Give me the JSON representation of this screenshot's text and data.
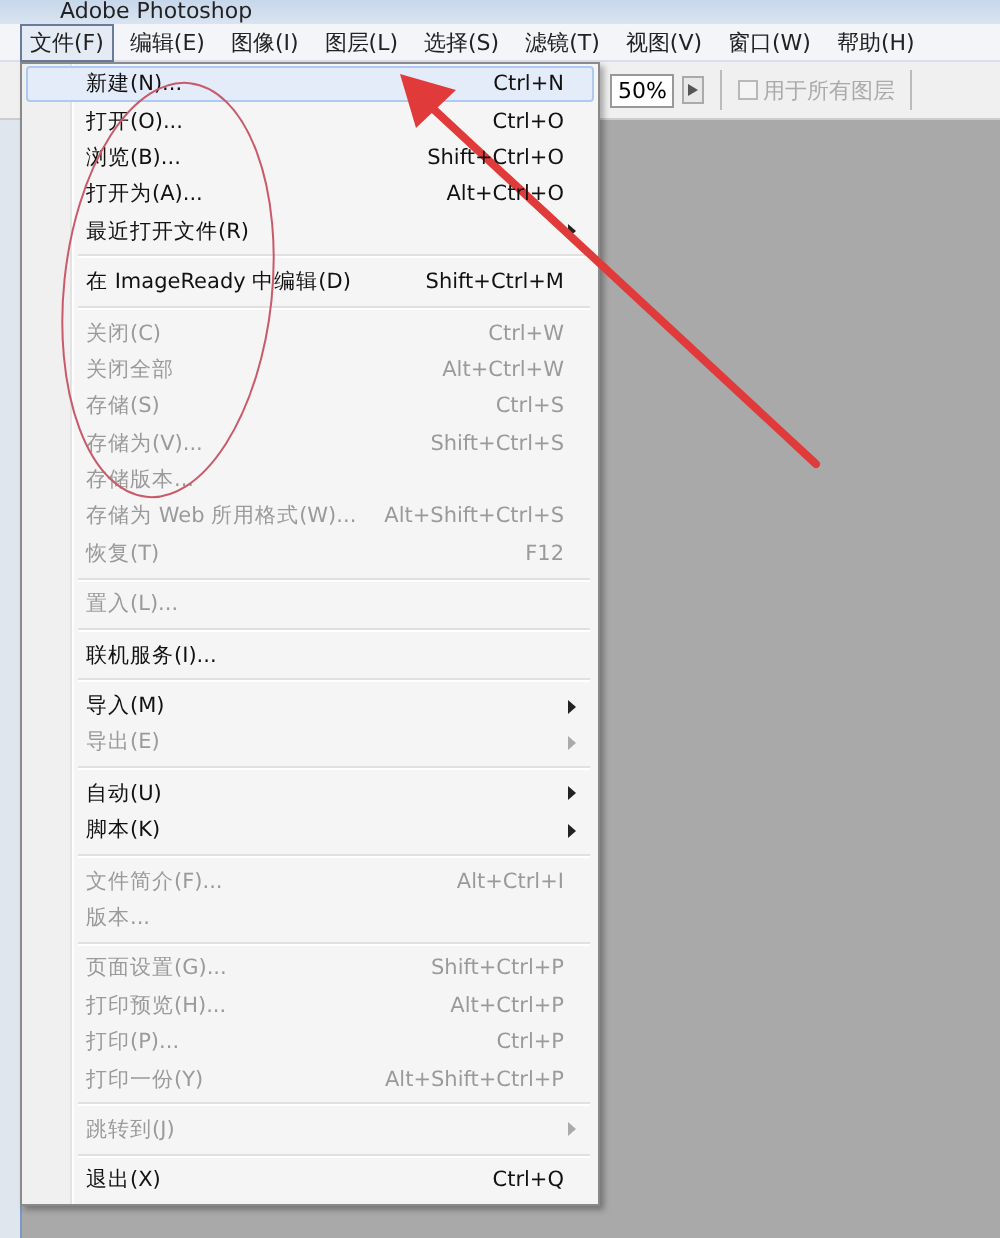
{
  "window": {
    "title": "Adobe Photoshop"
  },
  "menu_bar": [
    {
      "label": "文件(F)",
      "selected": true
    },
    {
      "label": "编辑(E)",
      "selected": false
    },
    {
      "label": "图像(I)",
      "selected": false
    },
    {
      "label": "图层(L)",
      "selected": false
    },
    {
      "label": "选择(S)",
      "selected": false
    },
    {
      "label": "滤镜(T)",
      "selected": false
    },
    {
      "label": "视图(V)",
      "selected": false
    },
    {
      "label": "窗口(W)",
      "selected": false
    },
    {
      "label": "帮助(H)",
      "selected": false
    }
  ],
  "options_bar": {
    "zoom_value": "50%",
    "all_layers": {
      "label": "用于所有图层",
      "checked": false,
      "disabled": true
    }
  },
  "file_menu": [
    [
      {
        "label": "新建(N)...",
        "shortcut": "Ctrl+N",
        "selected": true,
        "disabled": false,
        "submenu": false
      },
      {
        "label": "打开(O)...",
        "shortcut": "Ctrl+O",
        "selected": false,
        "disabled": false,
        "submenu": false
      },
      {
        "label": "浏览(B)...",
        "shortcut": "Shift+Ctrl+O",
        "selected": false,
        "disabled": false,
        "submenu": false
      },
      {
        "label": "打开为(A)...",
        "shortcut": "Alt+Ctrl+O",
        "selected": false,
        "disabled": false,
        "submenu": false
      },
      {
        "label": "最近打开文件(R)",
        "selected": false,
        "disabled": false,
        "submenu": true
      }
    ],
    [
      {
        "label": "在 ImageReady 中编辑(D)",
        "shortcut": "Shift+Ctrl+M",
        "selected": false,
        "disabled": false,
        "submenu": false
      }
    ],
    [
      {
        "label": "关闭(C)",
        "shortcut": "Ctrl+W",
        "selected": false,
        "disabled": true,
        "submenu": false
      },
      {
        "label": "关闭全部",
        "shortcut": "Alt+Ctrl+W",
        "selected": false,
        "disabled": true,
        "submenu": false
      },
      {
        "label": "存储(S)",
        "shortcut": "Ctrl+S",
        "selected": false,
        "disabled": true,
        "submenu": false
      },
      {
        "label": "存储为(V)...",
        "shortcut": "Shift+Ctrl+S",
        "selected": false,
        "disabled": true,
        "submenu": false
      },
      {
        "label": "存储版本...",
        "selected": false,
        "disabled": true,
        "submenu": false
      },
      {
        "label": "存储为 Web 所用格式(W)...",
        "shortcut": "Alt+Shift+Ctrl+S",
        "selected": false,
        "disabled": true,
        "submenu": false
      },
      {
        "label": "恢复(T)",
        "shortcut": "F12",
        "selected": false,
        "disabled": true,
        "submenu": false
      }
    ],
    [
      {
        "label": "置入(L)...",
        "selected": false,
        "disabled": true,
        "submenu": false
      }
    ],
    [
      {
        "label": "联机服务(I)...",
        "selected": false,
        "disabled": false,
        "submenu": false
      }
    ],
    [
      {
        "label": "导入(M)",
        "selected": false,
        "disabled": false,
        "submenu": true
      },
      {
        "label": "导出(E)",
        "selected": false,
        "disabled": true,
        "submenu": true
      }
    ],
    [
      {
        "label": "自动(U)",
        "selected": false,
        "disabled": false,
        "submenu": true
      },
      {
        "label": "脚本(K)",
        "selected": false,
        "disabled": false,
        "submenu": true
      }
    ],
    [
      {
        "label": "文件简介(F)...",
        "shortcut": "Alt+Ctrl+I",
        "selected": false,
        "disabled": true,
        "submenu": false
      },
      {
        "label": "版本...",
        "selected": false,
        "disabled": true,
        "submenu": false
      }
    ],
    [
      {
        "label": "页面设置(G)...",
        "shortcut": "Shift+Ctrl+P",
        "selected": false,
        "disabled": true,
        "submenu": false
      },
      {
        "label": "打印预览(H)...",
        "shortcut": "Alt+Ctrl+P",
        "selected": false,
        "disabled": true,
        "submenu": false
      },
      {
        "label": "打印(P)...",
        "shortcut": "Ctrl+P",
        "selected": false,
        "disabled": true,
        "submenu": false
      },
      {
        "label": "打印一份(Y)",
        "shortcut": "Alt+Shift+Ctrl+P",
        "selected": false,
        "disabled": true,
        "submenu": false
      }
    ],
    [
      {
        "label": "跳转到(J)",
        "selected": false,
        "disabled": true,
        "submenu": true
      }
    ],
    [
      {
        "label": "退出(X)",
        "shortcut": "Ctrl+Q",
        "selected": false,
        "disabled": false,
        "submenu": false
      }
    ]
  ]
}
